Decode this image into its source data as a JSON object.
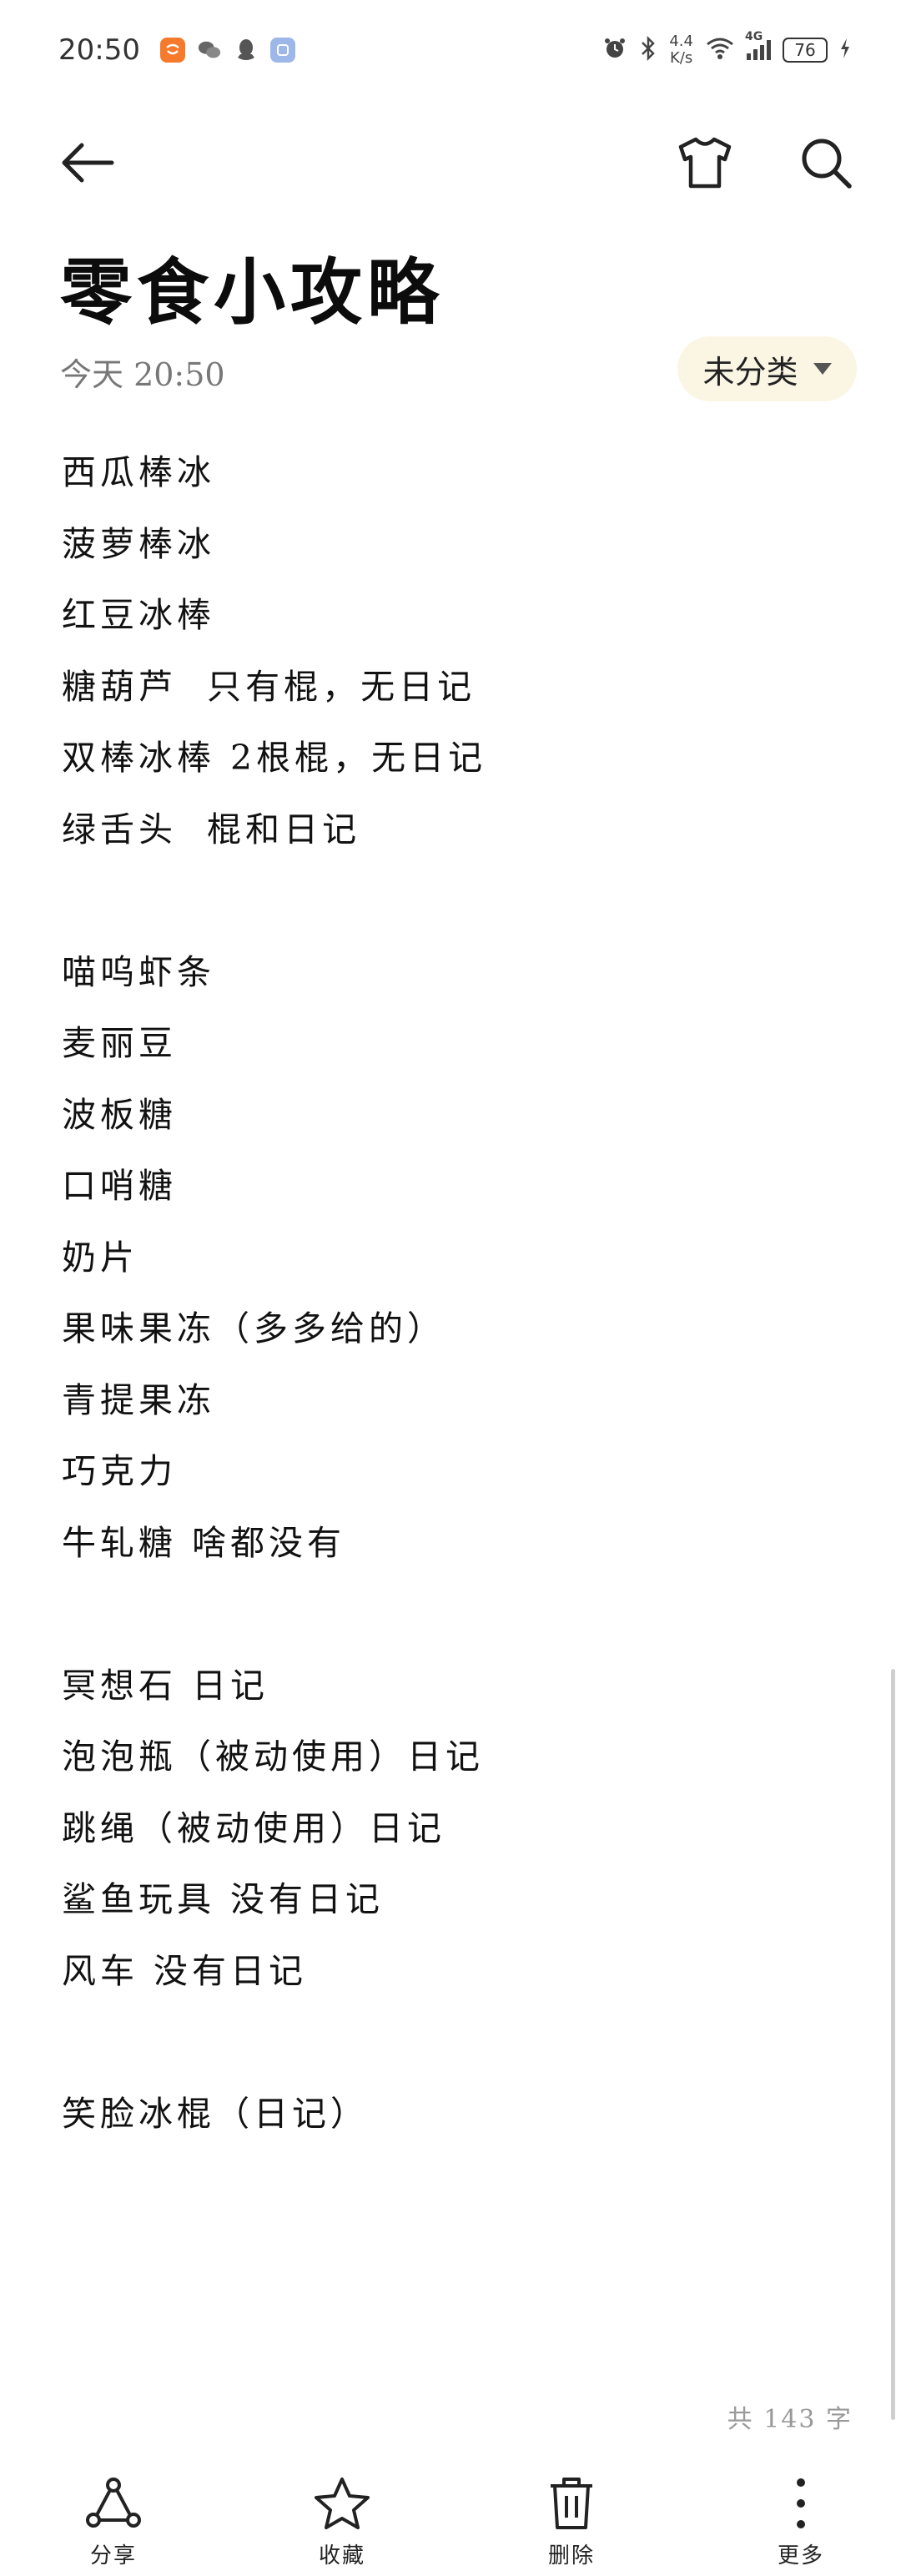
{
  "status_bar": {
    "time": "20:50",
    "net_speed_value": "4.4",
    "net_speed_unit": "K/s",
    "network_type": "4G",
    "battery": "76",
    "icons": [
      "taobao-icon",
      "wechat-icon",
      "qq-icon",
      "app-icon",
      "alarm-icon",
      "bluetooth-icon",
      "wifi-icon",
      "signal-icon",
      "battery-icon",
      "charging-icon"
    ]
  },
  "toolbar": {
    "back_icon": "back-arrow-icon",
    "theme_icon": "tshirt-icon",
    "search_icon": "search-icon"
  },
  "note": {
    "title": "零食小攻略",
    "date": "今天 20:50",
    "category": "未分类",
    "lines": [
      "西瓜棒冰",
      "菠萝棒冰",
      "红豆冰棒",
      "糖葫芦  只有棍，无日记",
      "双棒冰棒 2根棍，无日记",
      "绿舌头  棍和日记",
      "",
      "喵呜虾条",
      "麦丽豆",
      "波板糖",
      "口哨糖",
      "奶片",
      "果味果冻（多多给的）",
      "青提果冻",
      "巧克力",
      "牛轧糖 啥都没有",
      "",
      "冥想石 日记",
      "泡泡瓶（被动使用）日记",
      "跳绳（被动使用）日记",
      "鲨鱼玩具 没有日记",
      "风车 没有日记",
      "",
      "笑脸冰棍（日记）"
    ],
    "word_count": "共 143 字"
  },
  "bottom_bar": {
    "share": "分享",
    "favorite": "收藏",
    "delete": "删除",
    "more": "更多"
  }
}
